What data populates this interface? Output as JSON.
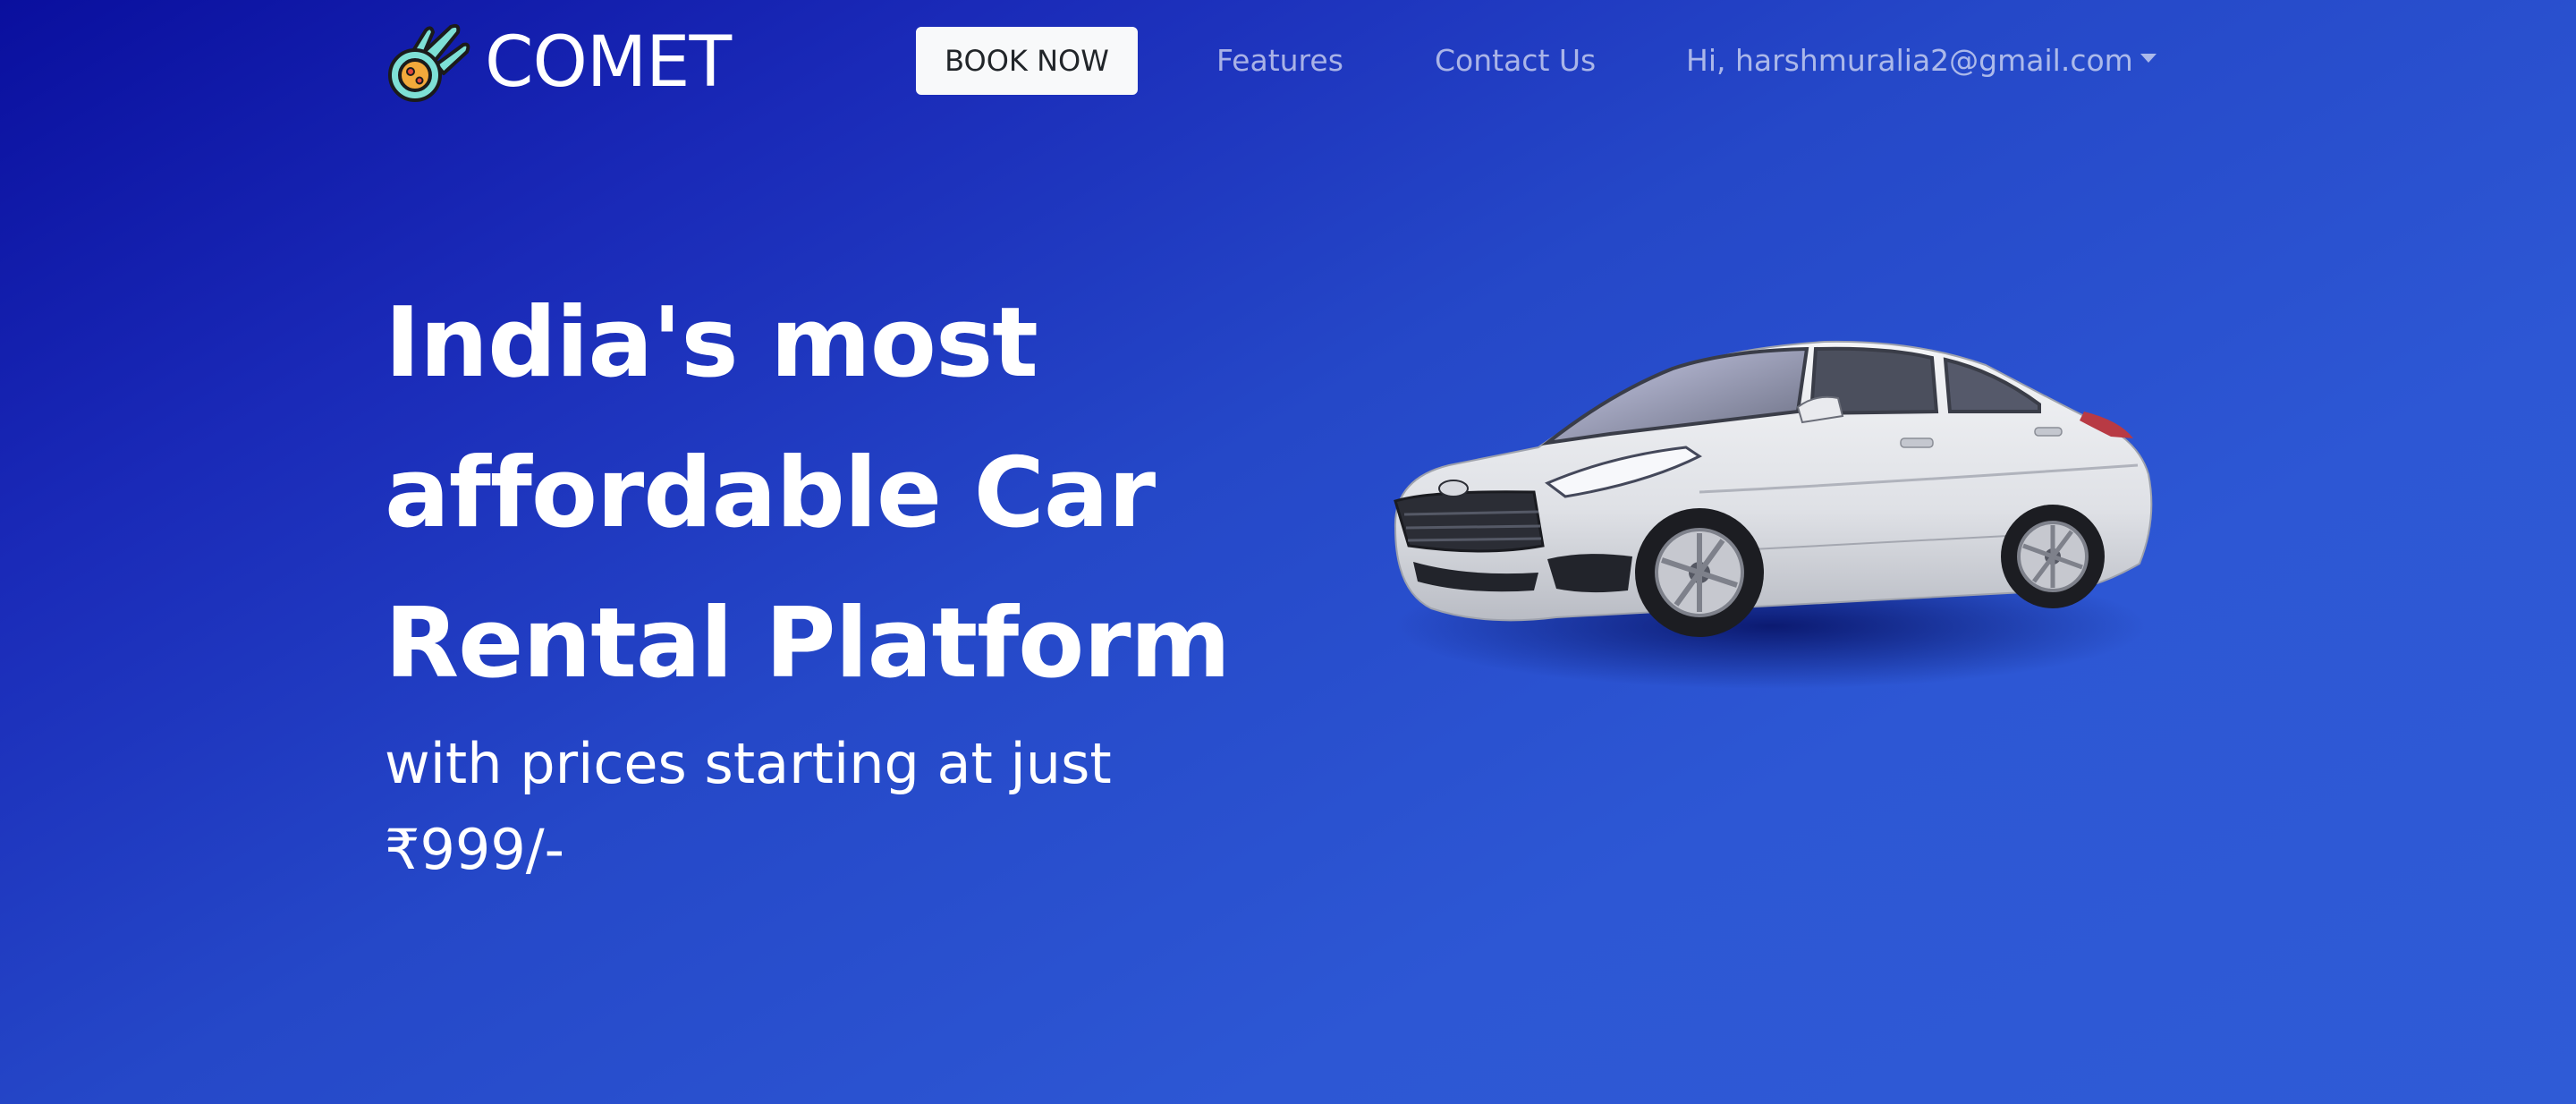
{
  "navbar": {
    "brand_name": "COMET",
    "logo_icon": "comet-icon",
    "book_now_label": "BOOK NOW",
    "features_label": "Features",
    "contact_label": "Contact Us",
    "user_label": "Hi, harshmuralia2@gmail.com"
  },
  "hero": {
    "title": "India's most affordable Car Rental Platform",
    "subtitle": "with prices starting at just ₹999/-",
    "image": "white-sedan-car"
  },
  "colors": {
    "background_start": "#0a0f9e",
    "background_end": "#2f5bd6",
    "button_bg": "#f8f9fa",
    "text": "#ffffff"
  }
}
